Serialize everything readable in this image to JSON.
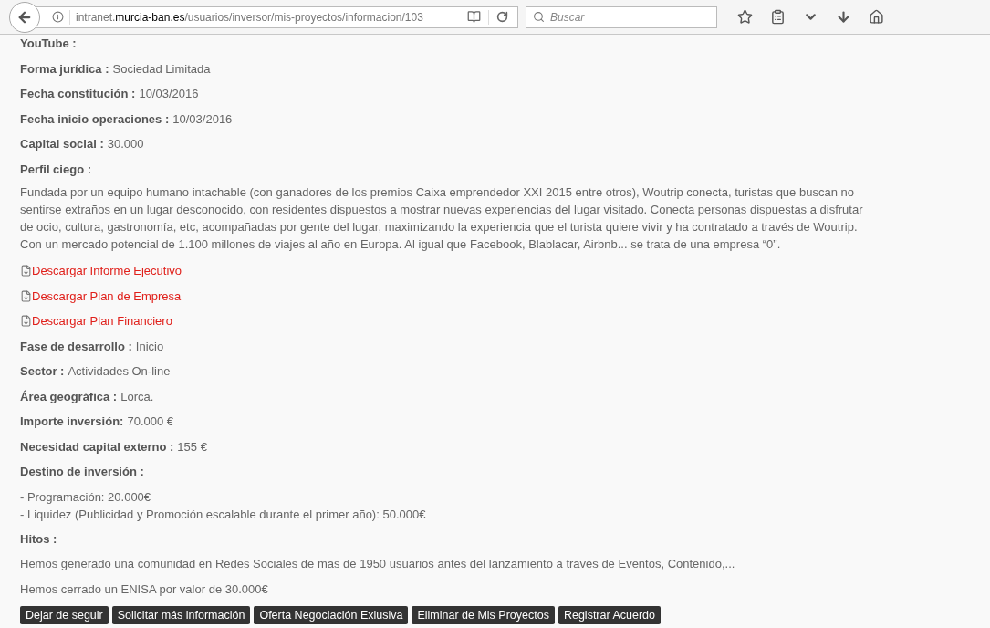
{
  "browser": {
    "url_parts": [
      {
        "text": "intranet.",
        "emphasis": false
      },
      {
        "text": "murcia-ban.es",
        "emphasis": true
      },
      {
        "text": "/usuarios/inversor/mis-proyectos/informacion/103",
        "emphasis": false
      }
    ],
    "search": {
      "placeholder": "Buscar"
    }
  },
  "content": [
    {
      "kind": "field",
      "label": "YouTube :"
    },
    {
      "kind": "field",
      "label": "Forma jurídica :",
      "value": "Sociedad Limitada"
    },
    {
      "kind": "field",
      "label": "Fecha constitución :",
      "value": "10/03/2016"
    },
    {
      "kind": "field",
      "label": "Fecha inicio operaciones :",
      "value": "10/03/2016"
    },
    {
      "kind": "field",
      "label": "Capital social :",
      "value": "30.000"
    },
    {
      "kind": "field",
      "label": "Perfil ciego :"
    },
    {
      "kind": "paragraph",
      "lines": [
        "Fundada por un equipo humano intachable (con ganadores de los premios Caixa emprendedor XXI 2015 entre otros), Woutrip conecta, turistas que buscan no",
        "sentirse extraños en un lugar desconocido, con residentes dispuestos a mostrar nuevas experiencias del lugar visitado. Conecta personas dispuestas a disfrutar",
        "de ocio, cultura, gastronomía, etc, acompañadas por gente del lugar, maximizando la experiencia que el turista quiere vivir y ha contratado a través de Woutrip.",
        "Con un mercado potencial de 1.100 millones de viajes al año en Europa. Al igual que Facebook, Blablacar, Airbnb... se trata de una empresa “0”."
      ]
    },
    {
      "kind": "link",
      "text": "Descargar Informe Ejecutivo"
    },
    {
      "kind": "link",
      "text": "Descargar Plan de Empresa"
    },
    {
      "kind": "link",
      "text": "Descargar Plan Financiero"
    },
    {
      "kind": "field",
      "label": "Fase de desarrollo :",
      "value": "Inicio"
    },
    {
      "kind": "field",
      "label": "Sector :",
      "value": "Actividades On-line"
    },
    {
      "kind": "field",
      "label": "Área geográfica :",
      "value": "Lorca."
    },
    {
      "kind": "field",
      "label": "Importe inversión:",
      "value": "70.000 €"
    },
    {
      "kind": "field",
      "label": "Necesidad capital externo :",
      "value": "155 €"
    },
    {
      "kind": "field",
      "label": "Destino de inversión :"
    },
    {
      "kind": "list",
      "lines": [
        "- Programación: 20.000€",
        "- Liquidez (Publicidad y Promoción escalable durante el primer año): 50.000€"
      ]
    },
    {
      "kind": "field",
      "label": "Hitos :"
    },
    {
      "kind": "text",
      "text": "Hemos generado una comunidad en Redes Sociales de mas de 1950 usuarios antes del lanzamiento a través de Eventos, Contenido,..."
    },
    {
      "kind": "text",
      "text": "Hemos cerrado un ENISA por valor de 30.000€"
    }
  ],
  "buttons": [
    "Dejar de seguir",
    "Solicitar más información",
    "Oferta Negociación Exlusiva",
    "Eliminar de Mis Proyectos",
    "Registrar Acuerdo"
  ]
}
